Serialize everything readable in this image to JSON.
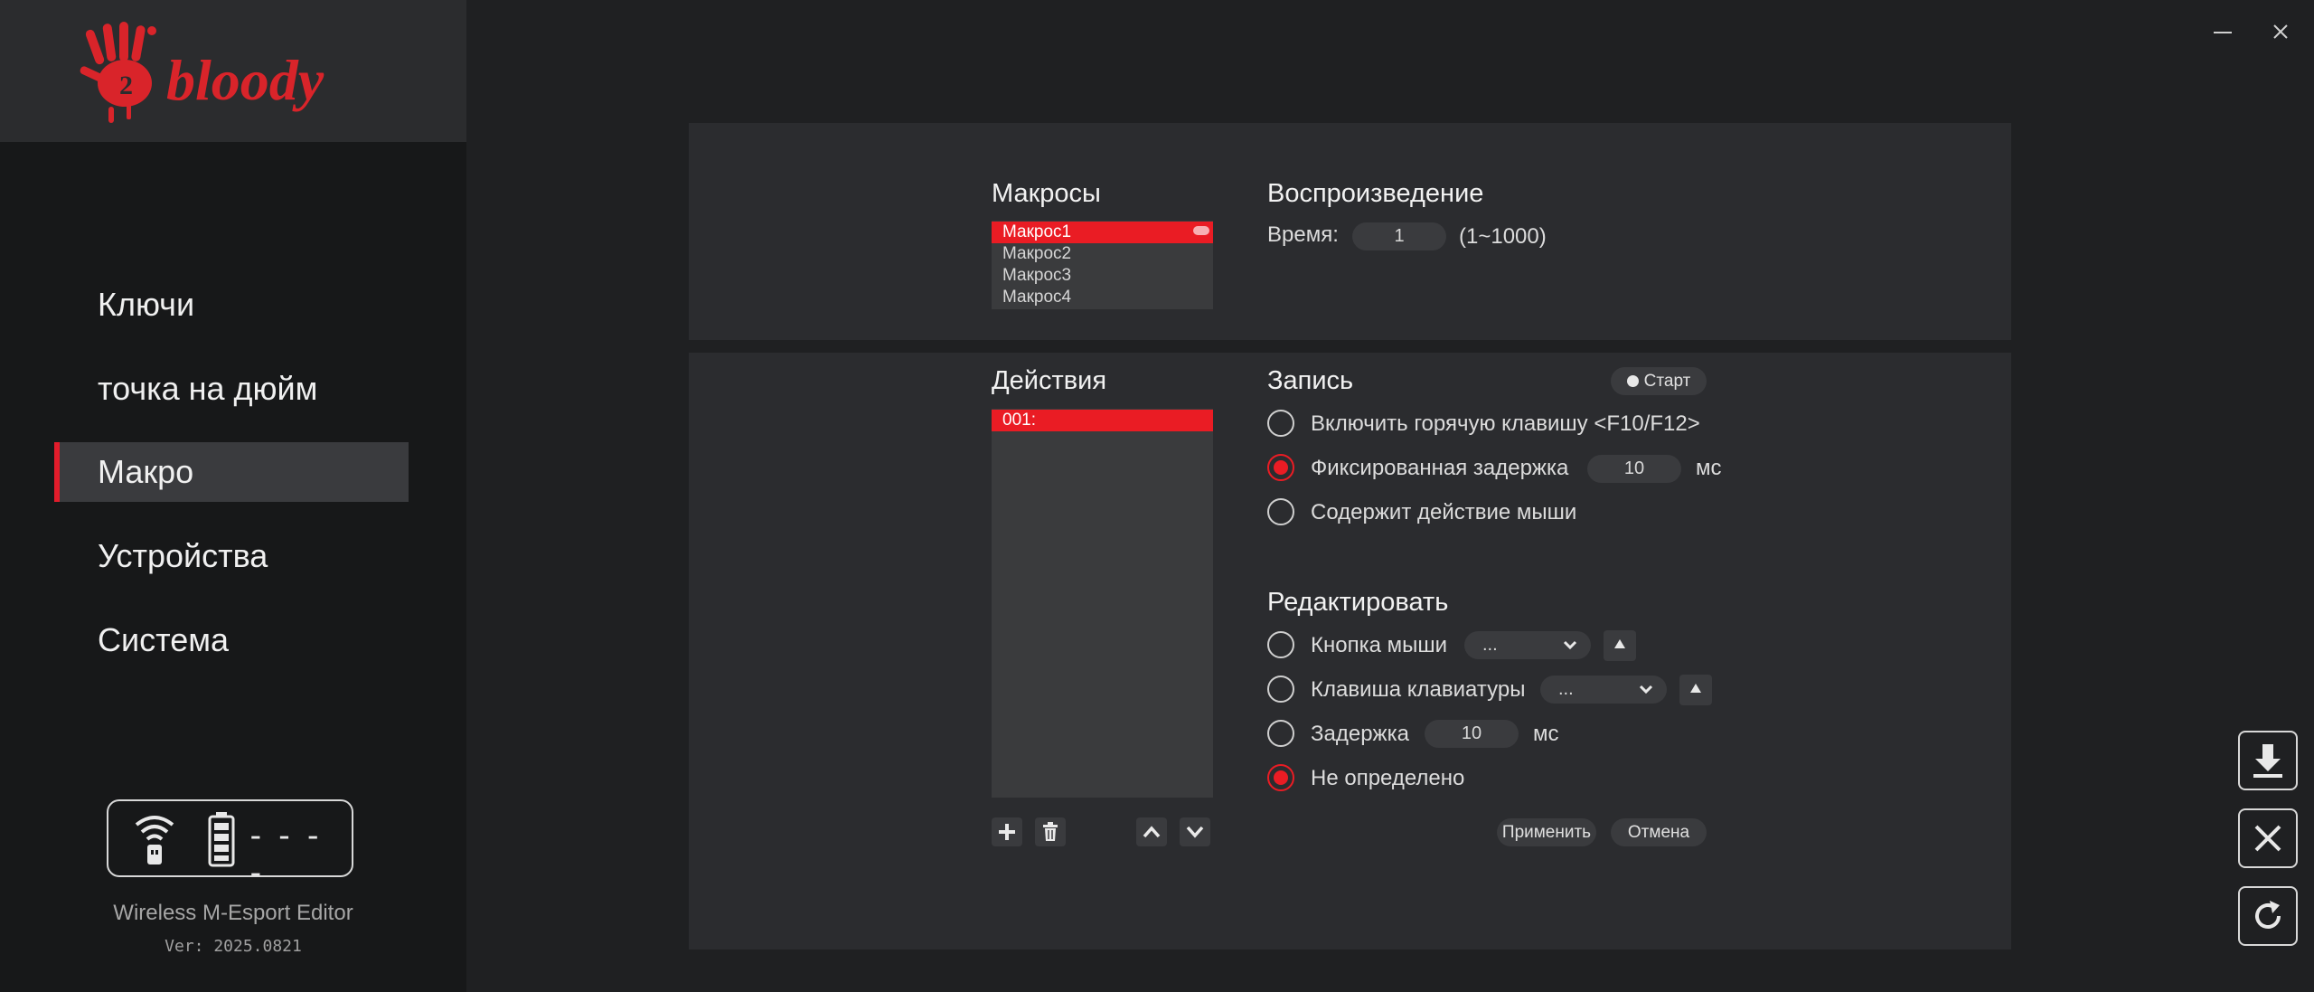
{
  "window": {
    "minimize_icon": "minimize-icon",
    "close_icon": "close-icon"
  },
  "brand": {
    "logo_text": "bloody"
  },
  "nav": [
    {
      "label": "Ключи"
    },
    {
      "label": "точка на дюйм"
    },
    {
      "label": "Макро",
      "active": true
    },
    {
      "label": "Устройства"
    },
    {
      "label": "Система"
    }
  ],
  "status": {
    "connection_text": "----"
  },
  "footer": {
    "app_name": "Wireless M-Esport Editor",
    "version": "Ver: 2025.0821"
  },
  "macros": {
    "title": "Макросы",
    "items": [
      "Макрос1",
      "Макрос2",
      "Макрос3",
      "Макрос4"
    ],
    "selected_index": 0
  },
  "playback": {
    "title": "Воспроизведение",
    "time_label": "Время:",
    "time_value": "1",
    "time_range": "(1~1000)"
  },
  "actions": {
    "title": "Действия",
    "items": [
      "001:"
    ]
  },
  "record": {
    "title": "Запись",
    "start_label": "Старт",
    "hotkey_label": "Включить горячую клавишу <F10/F12>",
    "fixed_delay_label": "Фиксированная задержка",
    "fixed_delay_value": "10",
    "fixed_delay_unit": "мс",
    "mouse_action_label": "Содержит действие мыши"
  },
  "edit": {
    "title": "Редактировать",
    "mouse_button_label": "Кнопка мыши",
    "mouse_button_value": "...",
    "keyboard_key_label": "Клавиша клавиатуры",
    "keyboard_key_value": "...",
    "delay_label": "Задержка",
    "delay_value": "10",
    "delay_unit": "мс",
    "undefined_label": "Не определено",
    "apply_label": "Применить",
    "cancel_label": "Отмена"
  },
  "colors": {
    "accent": "#ea1c24",
    "background": "#1f2022",
    "panel": "#2b2c2f"
  }
}
